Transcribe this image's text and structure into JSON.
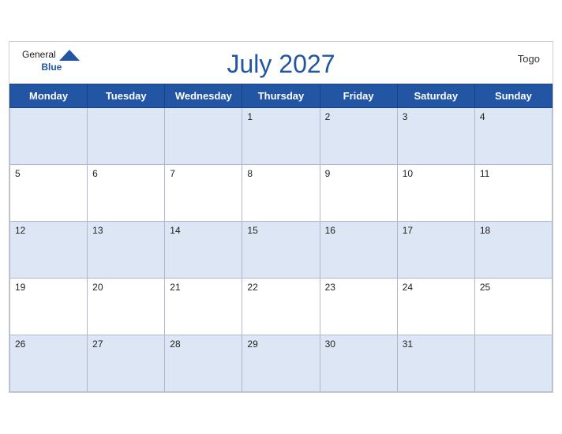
{
  "header": {
    "brand_general": "General",
    "brand_blue": "Blue",
    "month_title": "July 2027",
    "country": "Togo"
  },
  "weekdays": [
    "Monday",
    "Tuesday",
    "Wednesday",
    "Thursday",
    "Friday",
    "Saturday",
    "Sunday"
  ],
  "weeks": [
    [
      "",
      "",
      "",
      "1",
      "2",
      "3",
      "4"
    ],
    [
      "5",
      "6",
      "7",
      "8",
      "9",
      "10",
      "11"
    ],
    [
      "12",
      "13",
      "14",
      "15",
      "16",
      "17",
      "18"
    ],
    [
      "19",
      "20",
      "21",
      "22",
      "23",
      "24",
      "25"
    ],
    [
      "26",
      "27",
      "28",
      "29",
      "30",
      "31",
      ""
    ]
  ]
}
